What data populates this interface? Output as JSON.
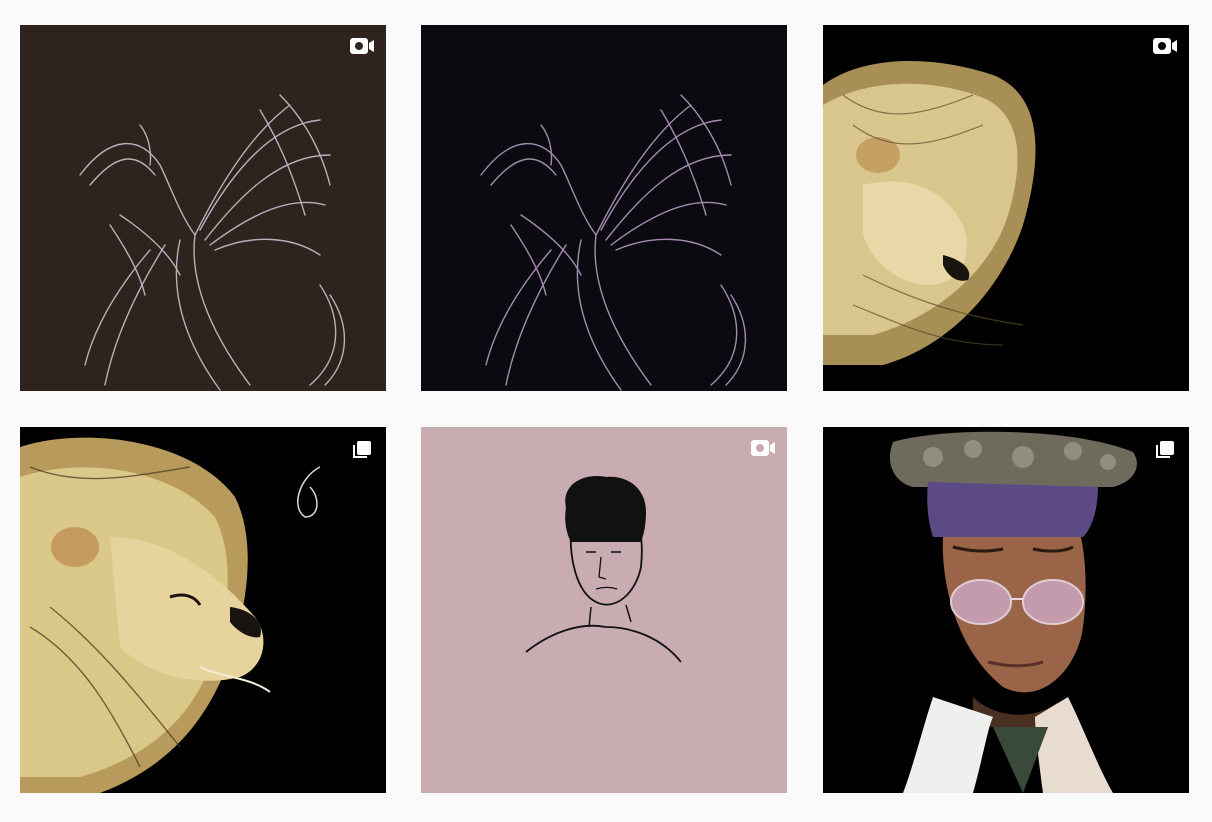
{
  "posts": [
    {
      "id": "post-1",
      "type": "video",
      "badge_icon": "video-icon",
      "bg": "#2e231d",
      "stroke": "#d8c6d8",
      "subject": "phoenix"
    },
    {
      "id": "post-2",
      "type": "video",
      "badge_icon": "video-icon",
      "bg": "#0a0a10",
      "stroke": "#b49ac0",
      "subject": "phoenix"
    },
    {
      "id": "post-3",
      "type": "video",
      "badge_icon": "video-icon",
      "bg": "#000000",
      "stroke": "#e8d9a0",
      "subject": "lion-roar"
    },
    {
      "id": "post-4",
      "type": "carousel",
      "badge_icon": "carousel-icon",
      "bg": "#000000",
      "stroke": "#e8d9a0",
      "subject": "lion-profile"
    },
    {
      "id": "post-5",
      "type": "video",
      "badge_icon": "video-icon",
      "bg": "#c9abb2",
      "stroke": "#111111",
      "subject": "line-portrait"
    },
    {
      "id": "post-6",
      "type": "carousel",
      "badge_icon": "carousel-icon",
      "bg": "#000000",
      "stroke": "#8a5a40",
      "subject": "hat-portrait"
    }
  ]
}
